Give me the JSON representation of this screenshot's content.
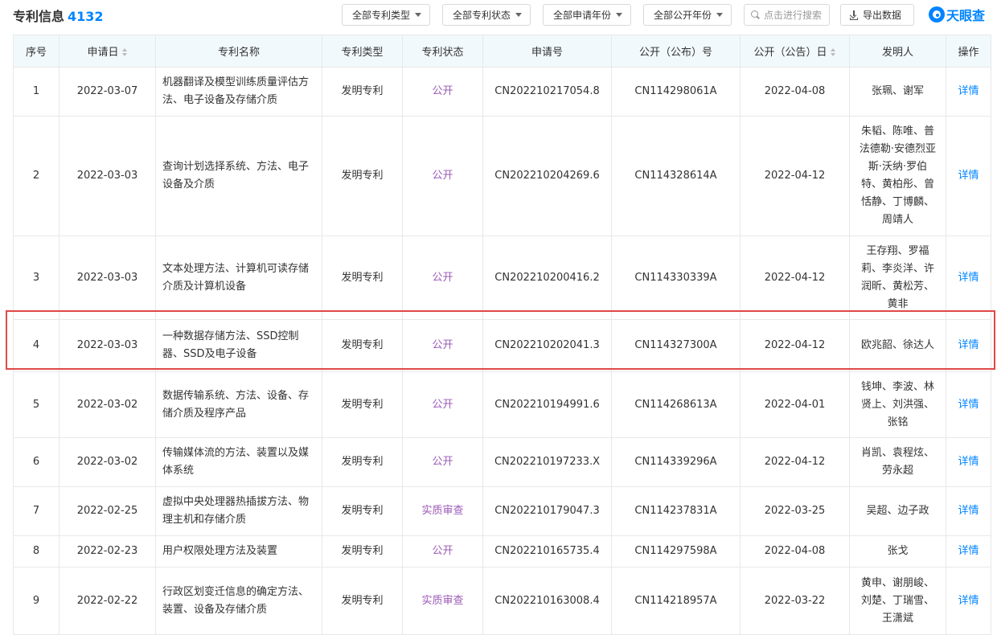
{
  "header": {
    "title": "专利信息",
    "count": "4132"
  },
  "filters": {
    "type": "全部专利类型",
    "status": "全部专利状态",
    "apply_year": "全部申请年份",
    "publish_year": "全部公开年份"
  },
  "search": {
    "placeholder": "点击进行搜索"
  },
  "export_label": "导出数据",
  "logo_text": "天眼查",
  "columns": {
    "index": "序号",
    "apply_date": "申请日",
    "name": "专利名称",
    "type": "专利类型",
    "status": "专利状态",
    "apply_no": "申请号",
    "pub_no": "公开（公布）号",
    "pub_date": "公开（公告）日",
    "inventors": "发明人",
    "action": "操作"
  },
  "colors": {
    "accent": "#0084ff",
    "status": "#9b59b6",
    "header_bg": "#f2f9fc",
    "highlight": "#e04848"
  },
  "rows": [
    {
      "index": "1",
      "apply_date": "2022-03-07",
      "name": "机器翻译及模型训练质量评估方法、电子设备及存储介质",
      "type": "发明专利",
      "status": "公开",
      "apply_no": "CN202210217054.8",
      "pub_no": "CN114298061A",
      "pub_date": "2022-04-08",
      "inventors": "张珮、谢军",
      "action": "详情"
    },
    {
      "index": "2",
      "apply_date": "2022-03-03",
      "name": "查询计划选择系统、方法、电子设备及介质",
      "type": "发明专利",
      "status": "公开",
      "apply_no": "CN202210204269.6",
      "pub_no": "CN114328614A",
      "pub_date": "2022-04-12",
      "inventors": "朱韬、陈唯、普法德勒·安德烈亚斯·沃纳·罗伯特、黄柏彤、曾恬静、丁博麟、周靖人",
      "action": "详情"
    },
    {
      "index": "3",
      "apply_date": "2022-03-03",
      "name": "文本处理方法、计算机可读存储介质及计算机设备",
      "type": "发明专利",
      "status": "公开",
      "apply_no": "CN202210200416.2",
      "pub_no": "CN114330339A",
      "pub_date": "2022-04-12",
      "inventors": "王存翔、罗福莉、李炎洋、许润昕、黄松芳、黄非",
      "action": "详情"
    },
    {
      "index": "4",
      "apply_date": "2022-03-03",
      "name": "一种数据存储方法、SSD控制器、SSD及电子设备",
      "type": "发明专利",
      "status": "公开",
      "apply_no": "CN202210202041.3",
      "pub_no": "CN114327300A",
      "pub_date": "2022-04-12",
      "inventors": "欧兆韶、徐达人",
      "action": "详情"
    },
    {
      "index": "5",
      "apply_date": "2022-03-02",
      "name": "数据传输系统、方法、设备、存储介质及程序产品",
      "type": "发明专利",
      "status": "公开",
      "apply_no": "CN202210194991.6",
      "pub_no": "CN114268613A",
      "pub_date": "2022-04-01",
      "inventors": "钱坤、李波、林贤上、刘洪强、张铭",
      "action": "详情"
    },
    {
      "index": "6",
      "apply_date": "2022-03-02",
      "name": "传输媒体流的方法、装置以及媒体系统",
      "type": "发明专利",
      "status": "公开",
      "apply_no": "CN202210197233.X",
      "pub_no": "CN114339296A",
      "pub_date": "2022-04-12",
      "inventors": "肖凯、袁程炫、劳永超",
      "action": "详情"
    },
    {
      "index": "7",
      "apply_date": "2022-02-25",
      "name": "虚拟中央处理器热插拔方法、物理主机和存储介质",
      "type": "发明专利",
      "status": "实质审查",
      "apply_no": "CN202210179047.3",
      "pub_no": "CN114237831A",
      "pub_date": "2022-03-25",
      "inventors": "吴超、边子政",
      "action": "详情"
    },
    {
      "index": "8",
      "apply_date": "2022-02-23",
      "name": "用户权限处理方法及装置",
      "type": "发明专利",
      "status": "公开",
      "apply_no": "CN202210165735.4",
      "pub_no": "CN114297598A",
      "pub_date": "2022-04-08",
      "inventors": "张戈",
      "action": "详情"
    },
    {
      "index": "9",
      "apply_date": "2022-02-22",
      "name": "行政区划变迁信息的确定方法、装置、设备及存储介质",
      "type": "发明专利",
      "status": "实质审查",
      "apply_no": "CN202210163008.4",
      "pub_no": "CN114218957A",
      "pub_date": "2022-03-22",
      "inventors": "黄申、谢朋峻、刘楚、丁瑞雪、王潇斌",
      "action": "详情"
    }
  ]
}
